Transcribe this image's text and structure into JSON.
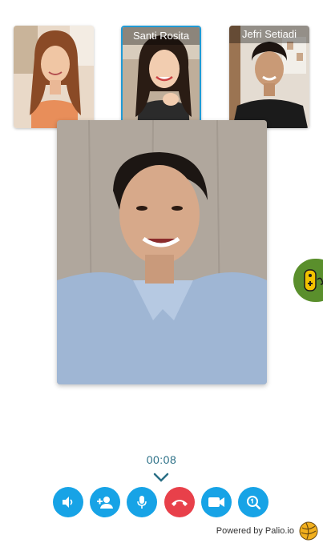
{
  "participants": [
    {
      "name": "",
      "active": false
    },
    {
      "name": "Santi Rosita",
      "active": true
    },
    {
      "name": "Jefri Setiadi",
      "active": false
    }
  ],
  "call": {
    "timer": "00:08"
  },
  "controls": [
    {
      "icon": "speaker-icon"
    },
    {
      "icon": "add-person-icon"
    },
    {
      "icon": "microphone-icon"
    },
    {
      "icon": "end-call-icon"
    },
    {
      "icon": "video-camera-icon"
    },
    {
      "icon": "zoom-icon"
    }
  ],
  "footer": {
    "powered_by": "Powered by Palio.io"
  },
  "colors": {
    "accent": "#17a3e6",
    "end_call": "#e8404a",
    "timer": "#2a6f86",
    "fab": "#5a8f2c"
  }
}
